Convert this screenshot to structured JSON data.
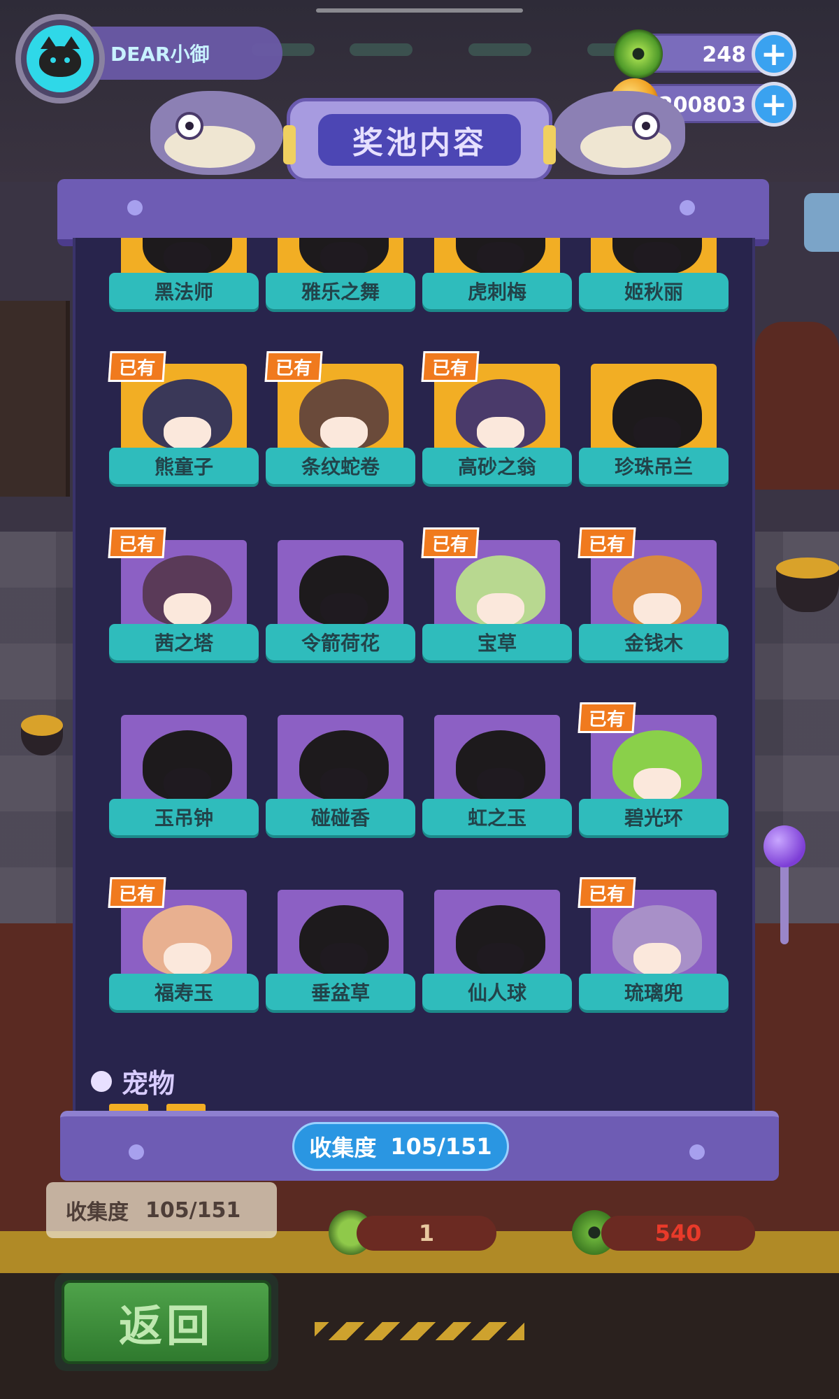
{
  "player": {
    "name": "DEAR小御"
  },
  "resources": {
    "gems": "248",
    "coins": "200803",
    "plus_label": "+"
  },
  "panel": {
    "title": "奖池内容",
    "owned_label": "已有",
    "items": [
      {
        "name": "黑法师",
        "owned": false,
        "plate": "gold"
      },
      {
        "name": "雅乐之舞",
        "owned": false,
        "plate": "gold"
      },
      {
        "name": "虎刺梅",
        "owned": false,
        "plate": "gold"
      },
      {
        "name": "姬秋丽",
        "owned": false,
        "plate": "gold"
      },
      {
        "name": "熊童子",
        "owned": true,
        "plate": "gold"
      },
      {
        "name": "条纹蛇卷",
        "owned": true,
        "plate": "gold"
      },
      {
        "name": "高砂之翁",
        "owned": true,
        "plate": "gold"
      },
      {
        "name": "珍珠吊兰",
        "owned": false,
        "plate": "gold"
      },
      {
        "name": "茜之塔",
        "owned": true,
        "plate": "purple"
      },
      {
        "name": "令箭荷花",
        "owned": false,
        "plate": "purple"
      },
      {
        "name": "宝草",
        "owned": true,
        "plate": "purple"
      },
      {
        "name": "金钱木",
        "owned": true,
        "plate": "purple"
      },
      {
        "name": "玉吊钟",
        "owned": false,
        "plate": "purple"
      },
      {
        "name": "碰碰香",
        "owned": false,
        "plate": "purple"
      },
      {
        "name": "虹之玉",
        "owned": false,
        "plate": "purple"
      },
      {
        "name": "碧光环",
        "owned": true,
        "plate": "purple"
      },
      {
        "name": "福寿玉",
        "owned": true,
        "plate": "purple"
      },
      {
        "name": "垂盆草",
        "owned": false,
        "plate": "purple"
      },
      {
        "name": "仙人球",
        "owned": false,
        "plate": "purple"
      },
      {
        "name": "琉璃兜",
        "owned": true,
        "plate": "purple"
      }
    ],
    "section_label": "宠物",
    "collection_label": "收集度",
    "collection_value": "105/151"
  },
  "background": {
    "collection_label": "收集度",
    "collection_value": "105/151",
    "cost_one": "1",
    "cost_two": "540",
    "back_label": "返回"
  },
  "colors": {
    "gold_plate": "#f2ae24",
    "purple_plate": "#8c60c4",
    "name_bar": "#2fbcbc",
    "owned_badge": "#f07a1e",
    "collection_pill": "#2a96e2"
  }
}
